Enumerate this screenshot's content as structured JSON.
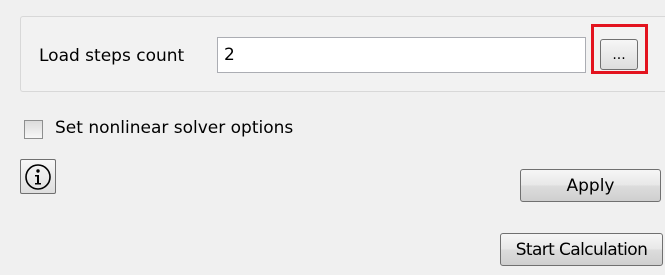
{
  "load_steps": {
    "label": "Load steps count",
    "value": "2",
    "browse_label": "..."
  },
  "nonlinear": {
    "label": "Set nonlinear solver options",
    "checked": false
  },
  "info": {
    "icon": "info-icon"
  },
  "actions": {
    "apply_label": "Apply",
    "start_label": "Start Calculation"
  },
  "colors": {
    "highlight": "#e3141f"
  }
}
